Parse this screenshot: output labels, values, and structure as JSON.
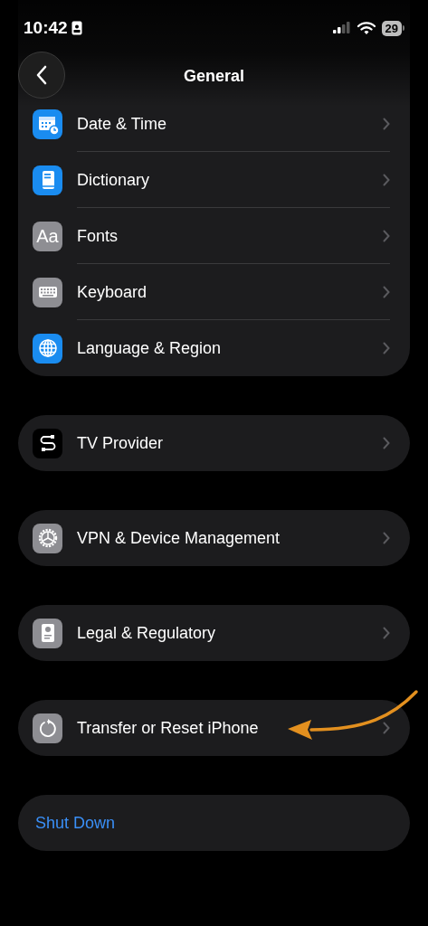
{
  "status_bar": {
    "time": "10:42",
    "battery": "29"
  },
  "nav": {
    "title": "General"
  },
  "groups": [
    {
      "rows": [
        {
          "label": "Date & Time"
        },
        {
          "label": "Dictionary"
        },
        {
          "label": "Fonts",
          "icon_text": "Aa"
        },
        {
          "label": "Keyboard"
        },
        {
          "label": "Language & Region"
        }
      ]
    },
    {
      "rows": [
        {
          "label": "TV Provider"
        }
      ]
    },
    {
      "rows": [
        {
          "label": "VPN & Device Management"
        }
      ]
    },
    {
      "rows": [
        {
          "label": "Legal & Regulatory"
        }
      ]
    },
    {
      "rows": [
        {
          "label": "Transfer or Reset iPhone"
        }
      ]
    }
  ],
  "shut_down": {
    "label": "Shut Down"
  }
}
